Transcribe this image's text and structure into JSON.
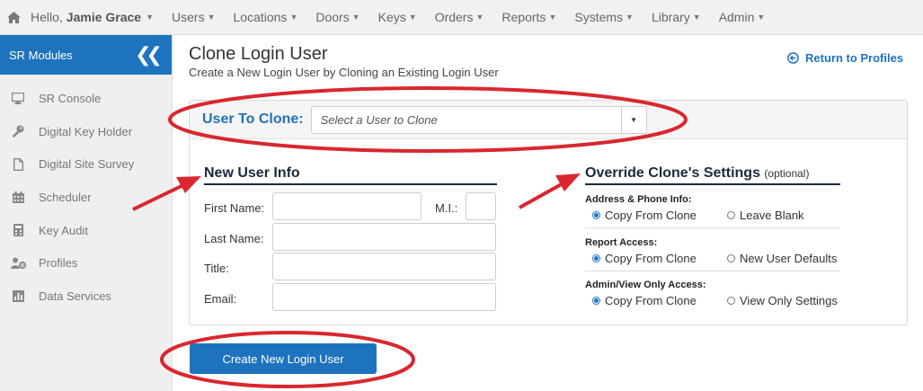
{
  "nav": {
    "greeting": "Hello,",
    "user": "Jamie Grace",
    "items": [
      "Users",
      "Locations",
      "Doors",
      "Keys",
      "Orders",
      "Reports",
      "Systems",
      "Library",
      "Admin"
    ]
  },
  "sidebar": {
    "title": "SR Modules",
    "items": [
      {
        "label": "SR Console",
        "icon": "monitor-icon"
      },
      {
        "label": "Digital Key Holder",
        "icon": "key-icon"
      },
      {
        "label": "Digital Site Survey",
        "icon": "document-icon"
      },
      {
        "label": "Scheduler",
        "icon": "calendar-icon"
      },
      {
        "label": "Key Audit",
        "icon": "calculator-icon"
      },
      {
        "label": "Profiles",
        "icon": "user-gear-icon"
      },
      {
        "label": "Data Services",
        "icon": "bar-chart-icon"
      }
    ]
  },
  "page": {
    "title": "Clone Login User",
    "subtitle": "Create a New Login User by Cloning an Existing Login User",
    "return_link": "Return to Profiles"
  },
  "clone": {
    "label": "User To Clone:",
    "placeholder": "Select a User to Clone"
  },
  "new_user": {
    "heading": "New User Info",
    "first_name": "First Name:",
    "mi": "M.I.:",
    "last_name": "Last Name:",
    "title": "Title:",
    "email": "Email:"
  },
  "override": {
    "heading": "Override Clone's Settings",
    "optional": "(optional)",
    "groups": [
      {
        "title": "Address & Phone Info:",
        "opt1": "Copy From Clone",
        "opt2": "Leave Blank"
      },
      {
        "title": "Report Access:",
        "opt1": "Copy From Clone",
        "opt2": "New User Defaults"
      },
      {
        "title": "Admin/View Only Access:",
        "opt1": "Copy From Clone",
        "opt2": "View Only Settings"
      }
    ]
  },
  "submit_label": "Create New Login User",
  "colors": {
    "accent": "#1e73be",
    "annotation": "#d9272e"
  }
}
